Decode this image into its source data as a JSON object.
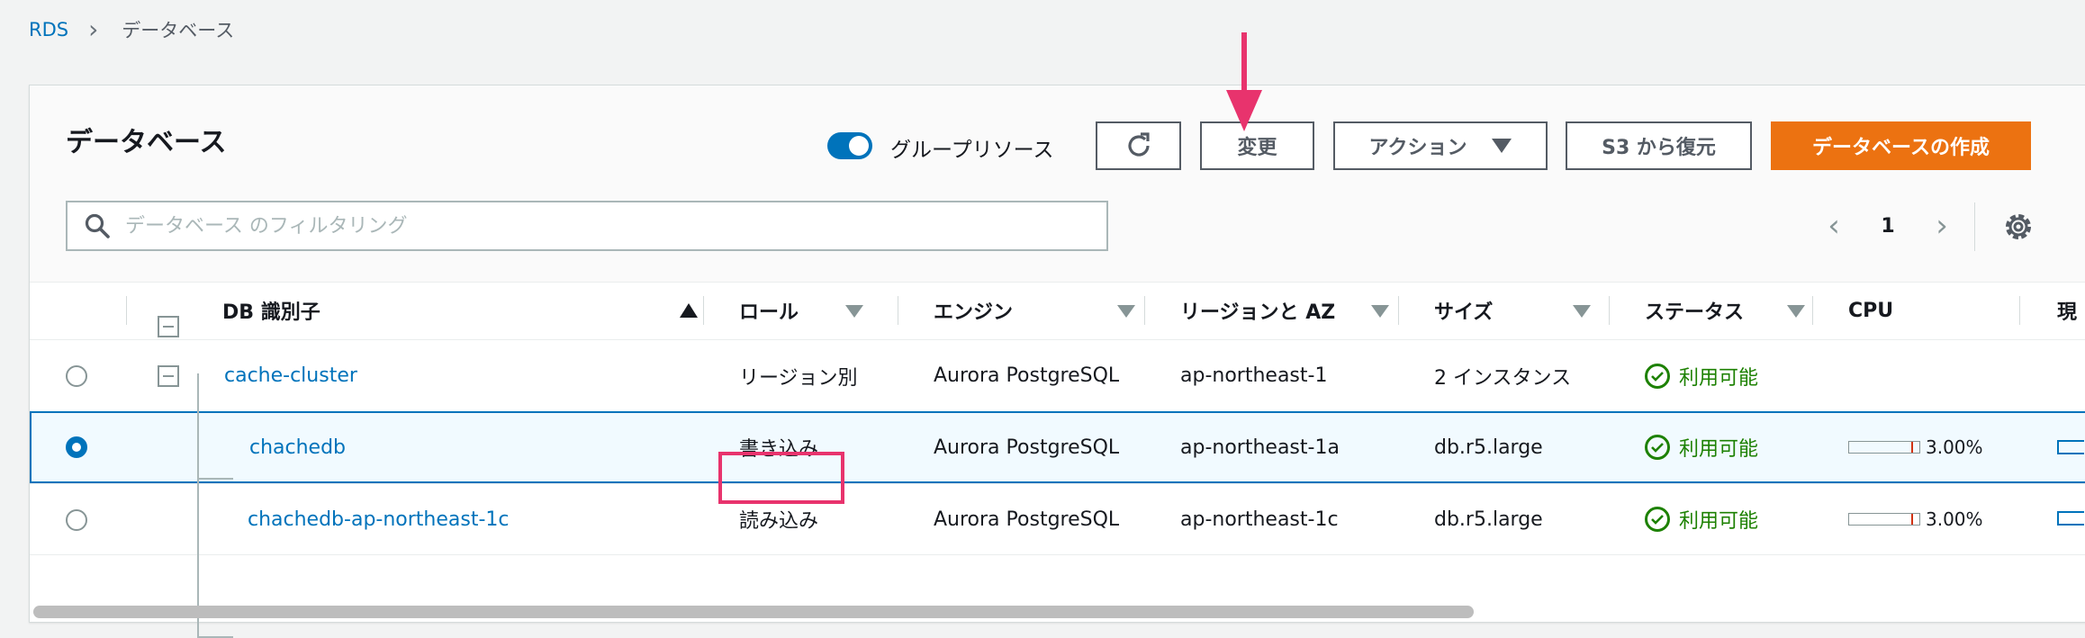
{
  "breadcrumb": {
    "root": "RDS",
    "current": "データベース"
  },
  "panel": {
    "title": "データベース"
  },
  "toggle": {
    "label": "グループリソース",
    "checked": true
  },
  "toolbar": {
    "modify_label": "変更",
    "actions_label": "アクション",
    "restore_label": "S3 から復元",
    "create_label": "データベースの作成"
  },
  "search": {
    "placeholder": "データベース のフィルタリング",
    "value": ""
  },
  "pagination": {
    "current": "1"
  },
  "table": {
    "headers": {
      "db_id": "DB 識別子",
      "role": "ロール",
      "engine": "エンジン",
      "region": "リージョンと AZ",
      "size": "サイズ",
      "status": "ステータス",
      "cpu": "CPU",
      "current": "現"
    },
    "rows": [
      {
        "id": "cache-cluster",
        "role": "リージョン別",
        "engine": "Aurora PostgreSQL",
        "region": "ap-northeast-1",
        "size": "2 インスタンス",
        "status": "利用可能",
        "cpu": "",
        "selected": false
      },
      {
        "id": "chachedb",
        "role": "書き込み",
        "engine": "Aurora PostgreSQL",
        "region": "ap-northeast-1a",
        "size": "db.r5.large",
        "status": "利用可能",
        "cpu": "3.00%",
        "selected": true
      },
      {
        "id": "chachedb-ap-northeast-1c",
        "role": "読み込み",
        "engine": "Aurora PostgreSQL",
        "region": "ap-northeast-1c",
        "size": "db.r5.large",
        "status": "利用可能",
        "cpu": "3.00%",
        "selected": false
      }
    ]
  },
  "colors": {
    "accent": "#0073bb",
    "primary_button": "#ec7211",
    "success": "#1d8102",
    "annotation": "#e8336d"
  },
  "icons": [
    "chevron-right-icon",
    "refresh-icon",
    "caret-down-icon",
    "search-icon",
    "chevron-left-icon",
    "gear-icon",
    "check-circle-icon",
    "sort-asc-icon"
  ]
}
